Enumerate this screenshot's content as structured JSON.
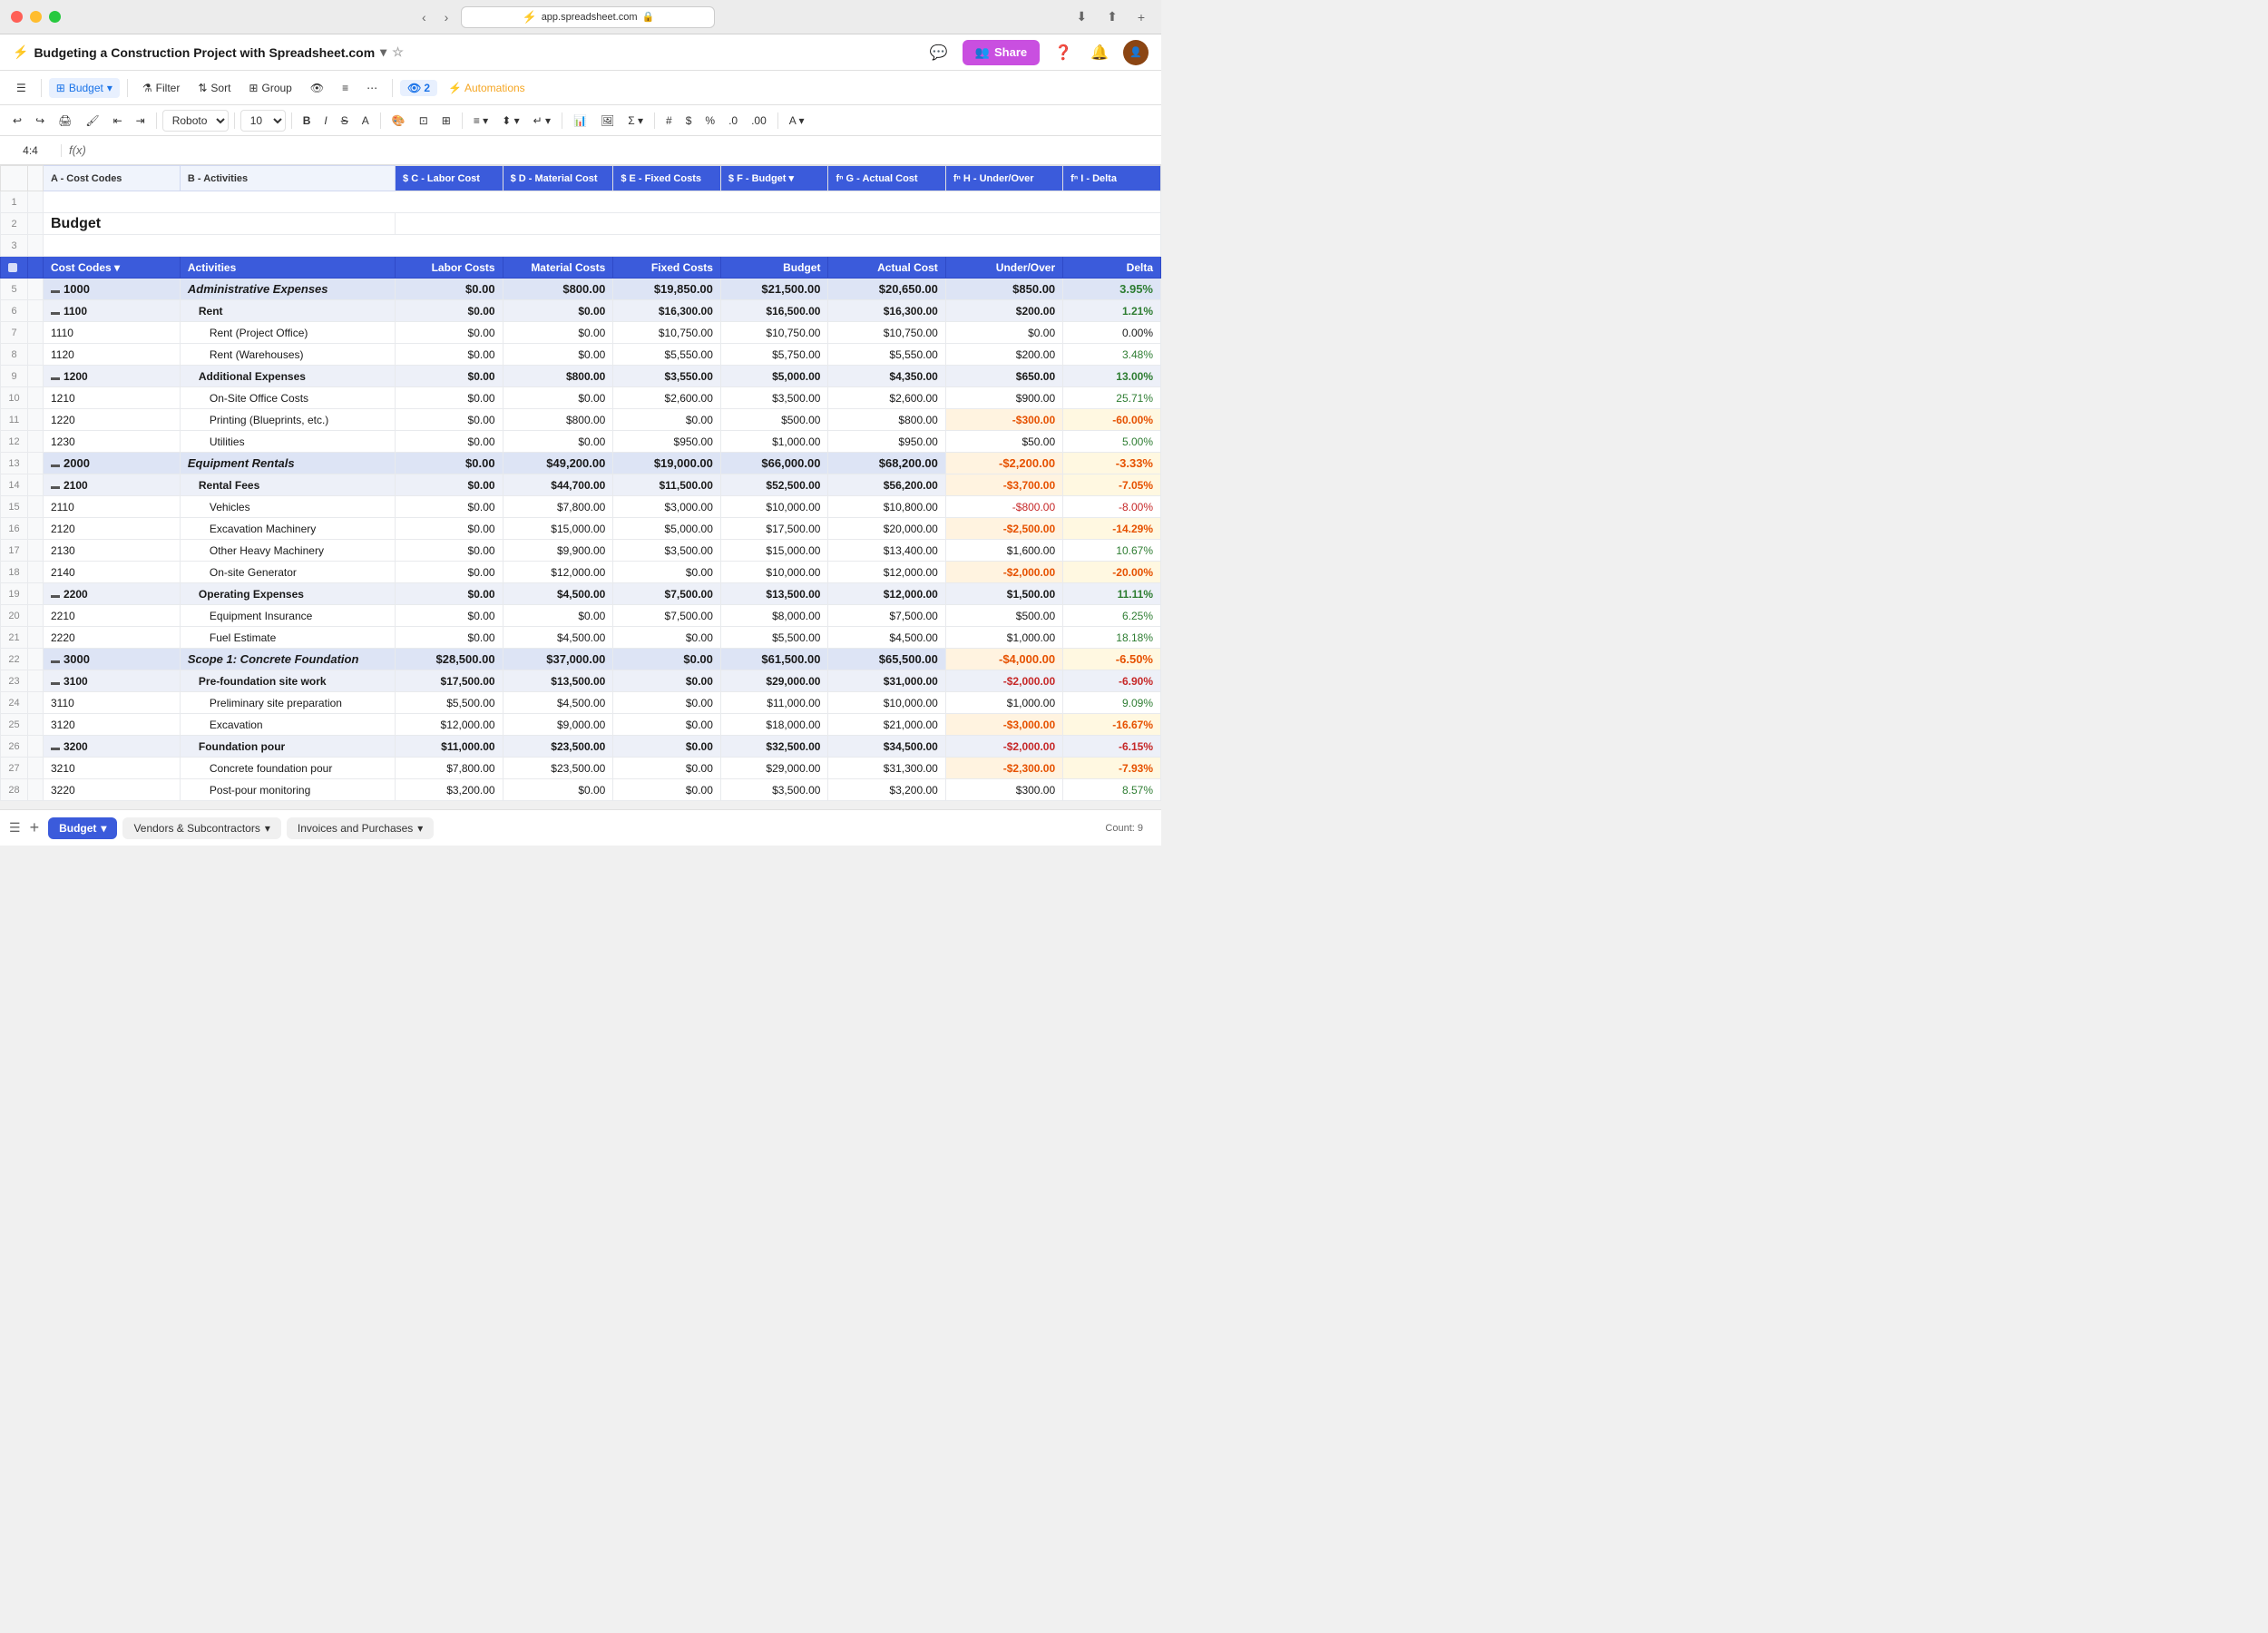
{
  "titleBar": {
    "url": "app.spreadsheet.com",
    "lock_icon": "🔒"
  },
  "appHeader": {
    "docTitle": "Budgeting a Construction Project with Spreadsheet.com",
    "shareLabel": "Share",
    "starIcon": "☆"
  },
  "toolbar": {
    "menuIcon": "☰",
    "addIcon": "+",
    "gridIcon": "⊞",
    "budgetLabel": "Budget",
    "filterLabel": "Filter",
    "sortLabel": "Sort",
    "groupLabel": "Group",
    "moreIcon": "⋯",
    "viewCount": "2",
    "automationsLabel": "Automations"
  },
  "formulaBar": {
    "cellRef": "4:4",
    "fxLabel": "f(x)"
  },
  "columns": [
    {
      "id": "A",
      "label": "A - Cost Codes"
    },
    {
      "id": "B",
      "label": "B - Activities"
    },
    {
      "id": "C",
      "label": "$ C - Labor Cost"
    },
    {
      "id": "D",
      "label": "$ D - Material Cost"
    },
    {
      "id": "E",
      "label": "$ E - Fixed Costs"
    },
    {
      "id": "F",
      "label": "$ F - Budget"
    },
    {
      "id": "G",
      "label": "fⁿ G - Actual Cost"
    },
    {
      "id": "H",
      "label": "fⁿ H - Under/Over"
    },
    {
      "id": "I",
      "label": "fⁿ I - Delta"
    }
  ],
  "headerRow": {
    "costCodes": "Cost Codes",
    "activities": "Activities",
    "laborCosts": "Labor Costs",
    "materialCosts": "Material Costs",
    "fixedCosts": "Fixed Costs",
    "budget": "Budget",
    "actualCost": "Actual Cost",
    "underOver": "Under/Over",
    "delta": "Delta"
  },
  "rows": [
    {
      "rowNum": 1,
      "type": "empty"
    },
    {
      "rowNum": 2,
      "type": "title",
      "title": "Budget"
    },
    {
      "rowNum": 3,
      "type": "empty"
    },
    {
      "rowNum": 4,
      "type": "header"
    },
    {
      "rowNum": 5,
      "type": "group1",
      "code": "1000",
      "activity": "Administrative Expenses",
      "labor": "$0.00",
      "material": "$800.00",
      "fixed": "$19,850.00",
      "budget": "$21,500.00",
      "actual": "$20,650.00",
      "underOver": "$850.00",
      "delta": "3.95%",
      "deltaType": "pos"
    },
    {
      "rowNum": 6,
      "type": "group2",
      "code": "1100",
      "activity": "Rent",
      "labor": "$0.00",
      "material": "$0.00",
      "fixed": "$16,300.00",
      "budget": "$16,500.00",
      "actual": "$16,300.00",
      "underOver": "$200.00",
      "delta": "1.21%",
      "deltaType": "pos"
    },
    {
      "rowNum": 7,
      "type": "normal",
      "code": "1110",
      "activity": "Rent (Project Office)",
      "labor": "$0.00",
      "material": "$0.00",
      "fixed": "$10,750.00",
      "budget": "$10,750.00",
      "actual": "$10,750.00",
      "underOver": "$0.00",
      "delta": "0.00%",
      "deltaType": "neutral"
    },
    {
      "rowNum": 8,
      "type": "normal",
      "code": "1120",
      "activity": "Rent (Warehouses)",
      "labor": "$0.00",
      "material": "$0.00",
      "fixed": "$5,550.00",
      "budget": "$5,750.00",
      "actual": "$5,550.00",
      "underOver": "$200.00",
      "delta": "3.48%",
      "deltaType": "pos"
    },
    {
      "rowNum": 9,
      "type": "group2",
      "code": "1200",
      "activity": "Additional Expenses",
      "labor": "$0.00",
      "material": "$800.00",
      "fixed": "$3,550.00",
      "budget": "$5,000.00",
      "actual": "$4,350.00",
      "underOver": "$650.00",
      "delta": "13.00%",
      "deltaType": "pos"
    },
    {
      "rowNum": 10,
      "type": "normal",
      "code": "1210",
      "activity": "On-Site Office Costs",
      "labor": "$0.00",
      "material": "$0.00",
      "fixed": "$2,600.00",
      "budget": "$3,500.00",
      "actual": "$2,600.00",
      "underOver": "$900.00",
      "delta": "25.71%",
      "deltaType": "pos"
    },
    {
      "rowNum": 11,
      "type": "normal",
      "code": "1220",
      "activity": "Printing (Blueprints, etc.)",
      "labor": "$0.00",
      "material": "$800.00",
      "fixed": "$0.00",
      "budget": "$500.00",
      "actual": "$800.00",
      "underOver": "-$300.00",
      "delta": "-60.00%",
      "deltaType": "neg-orange"
    },
    {
      "rowNum": 12,
      "type": "normal",
      "code": "1230",
      "activity": "Utilities",
      "labor": "$0.00",
      "material": "$0.00",
      "fixed": "$950.00",
      "budget": "$1,000.00",
      "actual": "$950.00",
      "underOver": "$50.00",
      "delta": "5.00%",
      "deltaType": "pos"
    },
    {
      "rowNum": 13,
      "type": "group1",
      "code": "2000",
      "activity": "Equipment Rentals",
      "labor": "$0.00",
      "material": "$49,200.00",
      "fixed": "$19,000.00",
      "budget": "$66,000.00",
      "actual": "$68,200.00",
      "underOver": "-$2,200.00",
      "delta": "-3.33%",
      "deltaType": "neg-orange"
    },
    {
      "rowNum": 14,
      "type": "group2",
      "code": "2100",
      "activity": "Rental Fees",
      "labor": "$0.00",
      "material": "$44,700.00",
      "fixed": "$11,500.00",
      "budget": "$52,500.00",
      "actual": "$56,200.00",
      "underOver": "-$3,700.00",
      "delta": "-7.05%",
      "deltaType": "neg-orange"
    },
    {
      "rowNum": 15,
      "type": "normal",
      "code": "2110",
      "activity": "Vehicles",
      "labor": "$0.00",
      "material": "$7,800.00",
      "fixed": "$3,000.00",
      "budget": "$10,000.00",
      "actual": "$10,800.00",
      "underOver": "-$800.00",
      "delta": "-8.00%",
      "deltaType": "neg"
    },
    {
      "rowNum": 16,
      "type": "normal",
      "code": "2120",
      "activity": "Excavation Machinery",
      "labor": "$0.00",
      "material": "$15,000.00",
      "fixed": "$5,000.00",
      "budget": "$17,500.00",
      "actual": "$20,000.00",
      "underOver": "-$2,500.00",
      "delta": "-14.29%",
      "deltaType": "neg-orange"
    },
    {
      "rowNum": 17,
      "type": "normal",
      "code": "2130",
      "activity": "Other Heavy Machinery",
      "labor": "$0.00",
      "material": "$9,900.00",
      "fixed": "$3,500.00",
      "budget": "$15,000.00",
      "actual": "$13,400.00",
      "underOver": "$1,600.00",
      "delta": "10.67%",
      "deltaType": "pos"
    },
    {
      "rowNum": 18,
      "type": "normal",
      "code": "2140",
      "activity": "On-site Generator",
      "labor": "$0.00",
      "material": "$12,000.00",
      "fixed": "$0.00",
      "budget": "$10,000.00",
      "actual": "$12,000.00",
      "underOver": "-$2,000.00",
      "delta": "-20.00%",
      "deltaType": "neg-orange"
    },
    {
      "rowNum": 19,
      "type": "group2",
      "code": "2200",
      "activity": "Operating Expenses",
      "labor": "$0.00",
      "material": "$4,500.00",
      "fixed": "$7,500.00",
      "budget": "$13,500.00",
      "actual": "$12,000.00",
      "underOver": "$1,500.00",
      "delta": "11.11%",
      "deltaType": "pos"
    },
    {
      "rowNum": 20,
      "type": "normal",
      "code": "2210",
      "activity": "Equipment Insurance",
      "labor": "$0.00",
      "material": "$0.00",
      "fixed": "$7,500.00",
      "budget": "$8,000.00",
      "actual": "$7,500.00",
      "underOver": "$500.00",
      "delta": "6.25%",
      "deltaType": "pos"
    },
    {
      "rowNum": 21,
      "type": "normal",
      "code": "2220",
      "activity": "Fuel Estimate",
      "labor": "$0.00",
      "material": "$4,500.00",
      "fixed": "$0.00",
      "budget": "$5,500.00",
      "actual": "$4,500.00",
      "underOver": "$1,000.00",
      "delta": "18.18%",
      "deltaType": "pos"
    },
    {
      "rowNum": 22,
      "type": "group1",
      "code": "3000",
      "activity": "Scope 1: Concrete Foundation",
      "labor": "$28,500.00",
      "material": "$37,000.00",
      "fixed": "$0.00",
      "budget": "$61,500.00",
      "actual": "$65,500.00",
      "underOver": "-$4,000.00",
      "delta": "-6.50%",
      "deltaType": "neg-orange"
    },
    {
      "rowNum": 23,
      "type": "group2",
      "code": "3100",
      "activity": "Pre-foundation site work",
      "labor": "$17,500.00",
      "material": "$13,500.00",
      "fixed": "$0.00",
      "budget": "$29,000.00",
      "actual": "$31,000.00",
      "underOver": "-$2,000.00",
      "delta": "-6.90%",
      "deltaType": "neg"
    },
    {
      "rowNum": 24,
      "type": "normal",
      "code": "3110",
      "activity": "Preliminary site preparation",
      "labor": "$5,500.00",
      "material": "$4,500.00",
      "fixed": "$0.00",
      "budget": "$11,000.00",
      "actual": "$10,000.00",
      "underOver": "$1,000.00",
      "delta": "9.09%",
      "deltaType": "pos"
    },
    {
      "rowNum": 25,
      "type": "normal",
      "code": "3120",
      "activity": "Excavation",
      "labor": "$12,000.00",
      "material": "$9,000.00",
      "fixed": "$0.00",
      "budget": "$18,000.00",
      "actual": "$21,000.00",
      "underOver": "-$3,000.00",
      "delta": "-16.67%",
      "deltaType": "neg-orange"
    },
    {
      "rowNum": 26,
      "type": "group2",
      "code": "3200",
      "activity": "Foundation pour",
      "labor": "$11,000.00",
      "material": "$23,500.00",
      "fixed": "$0.00",
      "budget": "$32,500.00",
      "actual": "$34,500.00",
      "underOver": "-$2,000.00",
      "delta": "-6.15%",
      "deltaType": "neg"
    },
    {
      "rowNum": 27,
      "type": "normal",
      "code": "3210",
      "activity": "Concrete foundation pour",
      "labor": "$7,800.00",
      "material": "$23,500.00",
      "fixed": "$0.00",
      "budget": "$29,000.00",
      "actual": "$31,300.00",
      "underOver": "-$2,300.00",
      "delta": "-7.93%",
      "deltaType": "neg-orange"
    },
    {
      "rowNum": 28,
      "type": "normal",
      "code": "3220",
      "activity": "Post-pour monitoring",
      "labor": "$3,200.00",
      "material": "$0.00",
      "fixed": "$0.00",
      "budget": "$3,500.00",
      "actual": "$3,200.00",
      "underOver": "$300.00",
      "delta": "8.57%",
      "deltaType": "pos"
    }
  ],
  "bottomTabs": {
    "menuIcon": "☰",
    "addIcon": "+",
    "budgetLabel": "Budget",
    "vendorsLabel": "Vendors & Subcontractors",
    "invoicesLabel": "Invoices and Purchases",
    "countLabel": "Count: 9"
  },
  "colors": {
    "headerBlue": "#3b5bdb",
    "negOrange": "#e65100",
    "negOrangeBg": "#fff8e1",
    "posGreen": "#2e7d32",
    "negRed": "#c62828"
  }
}
